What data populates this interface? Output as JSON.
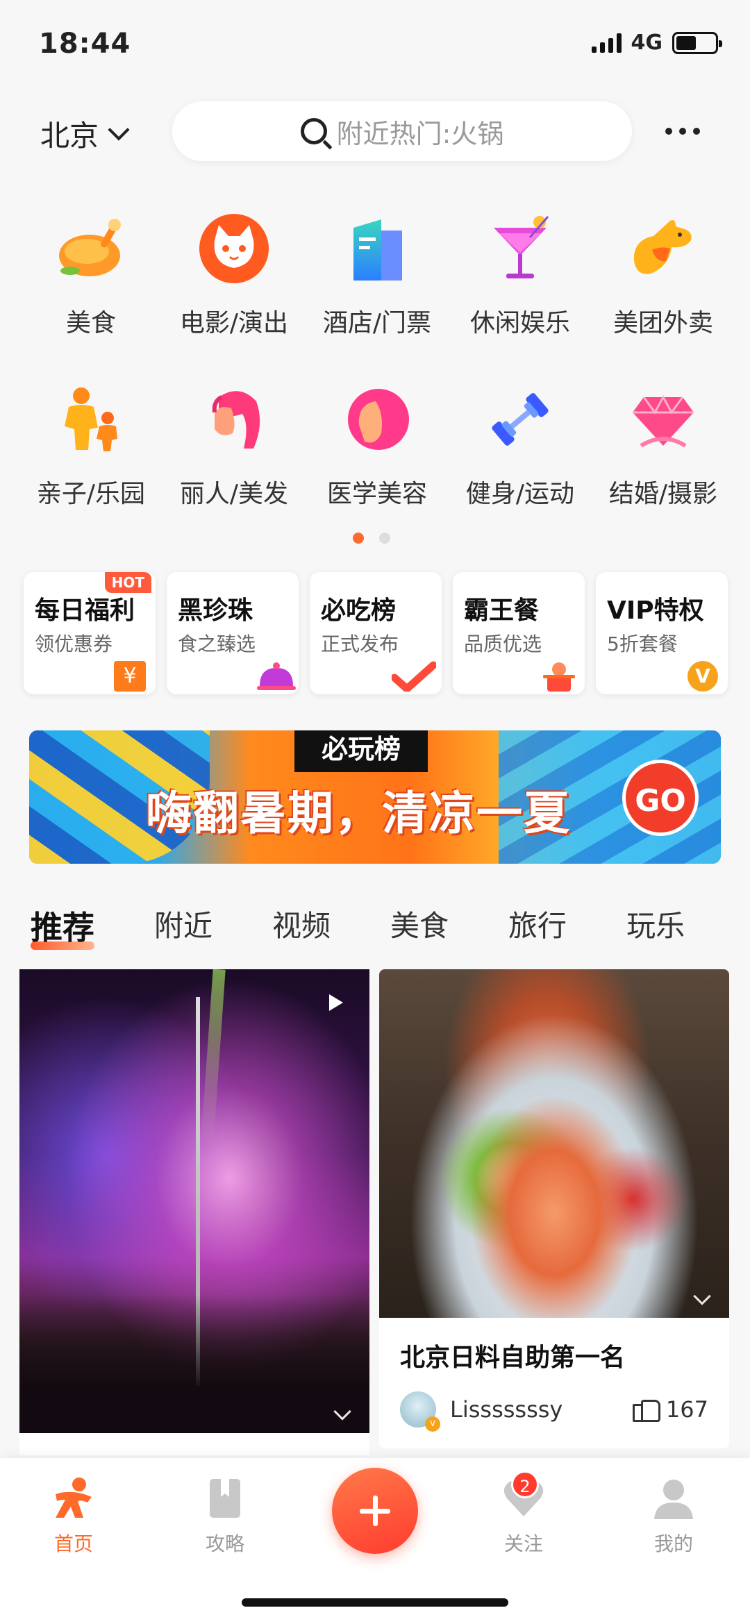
{
  "status": {
    "time": "18:44",
    "network": "4G"
  },
  "header": {
    "city": "北京",
    "search_placeholder": "附近热门:火锅"
  },
  "categories": [
    {
      "label": "美食",
      "icon": "roast-chicken-icon"
    },
    {
      "label": "电影/演出",
      "icon": "cat-face-icon"
    },
    {
      "label": "酒店/门票",
      "icon": "hotel-building-icon"
    },
    {
      "label": "休闲娱乐",
      "icon": "cocktail-icon"
    },
    {
      "label": "美团外卖",
      "icon": "kangaroo-icon"
    },
    {
      "label": "亲子/乐园",
      "icon": "parent-child-icon"
    },
    {
      "label": "丽人/美发",
      "icon": "hair-woman-icon"
    },
    {
      "label": "医学美容",
      "icon": "face-icon"
    },
    {
      "label": "健身/运动",
      "icon": "dumbbell-icon"
    },
    {
      "label": "结婚/摄影",
      "icon": "diamond-icon"
    }
  ],
  "promos": [
    {
      "title": "每日福利",
      "subtitle": "领优惠券",
      "badge": "HOT",
      "deco": "¥"
    },
    {
      "title": "黑珍珠",
      "subtitle": "食之臻选"
    },
    {
      "title": "必吃榜",
      "subtitle": "正式发布"
    },
    {
      "title": "霸王餐",
      "subtitle": "品质优选"
    },
    {
      "title": "VIP特权",
      "subtitle": "5折套餐",
      "deco": "V"
    }
  ],
  "banner": {
    "tag": "必玩榜",
    "headline": "嗨翻暑期，清凉一夏",
    "cta": "GO"
  },
  "tabs": [
    "推荐",
    "附近",
    "视频",
    "美食",
    "旅行",
    "玩乐"
  ],
  "feed": [
    {
      "type": "video"
    },
    {
      "title": "北京日料自助第一名",
      "user": "Lisssssssy",
      "likes": "167"
    }
  ],
  "nav": {
    "home": "首页",
    "guide": "攻略",
    "follow": "关注",
    "follow_badge": "2",
    "mine": "我的"
  },
  "colors": {
    "accent": "#ff6a2a",
    "fab": "#ff3b2e"
  }
}
